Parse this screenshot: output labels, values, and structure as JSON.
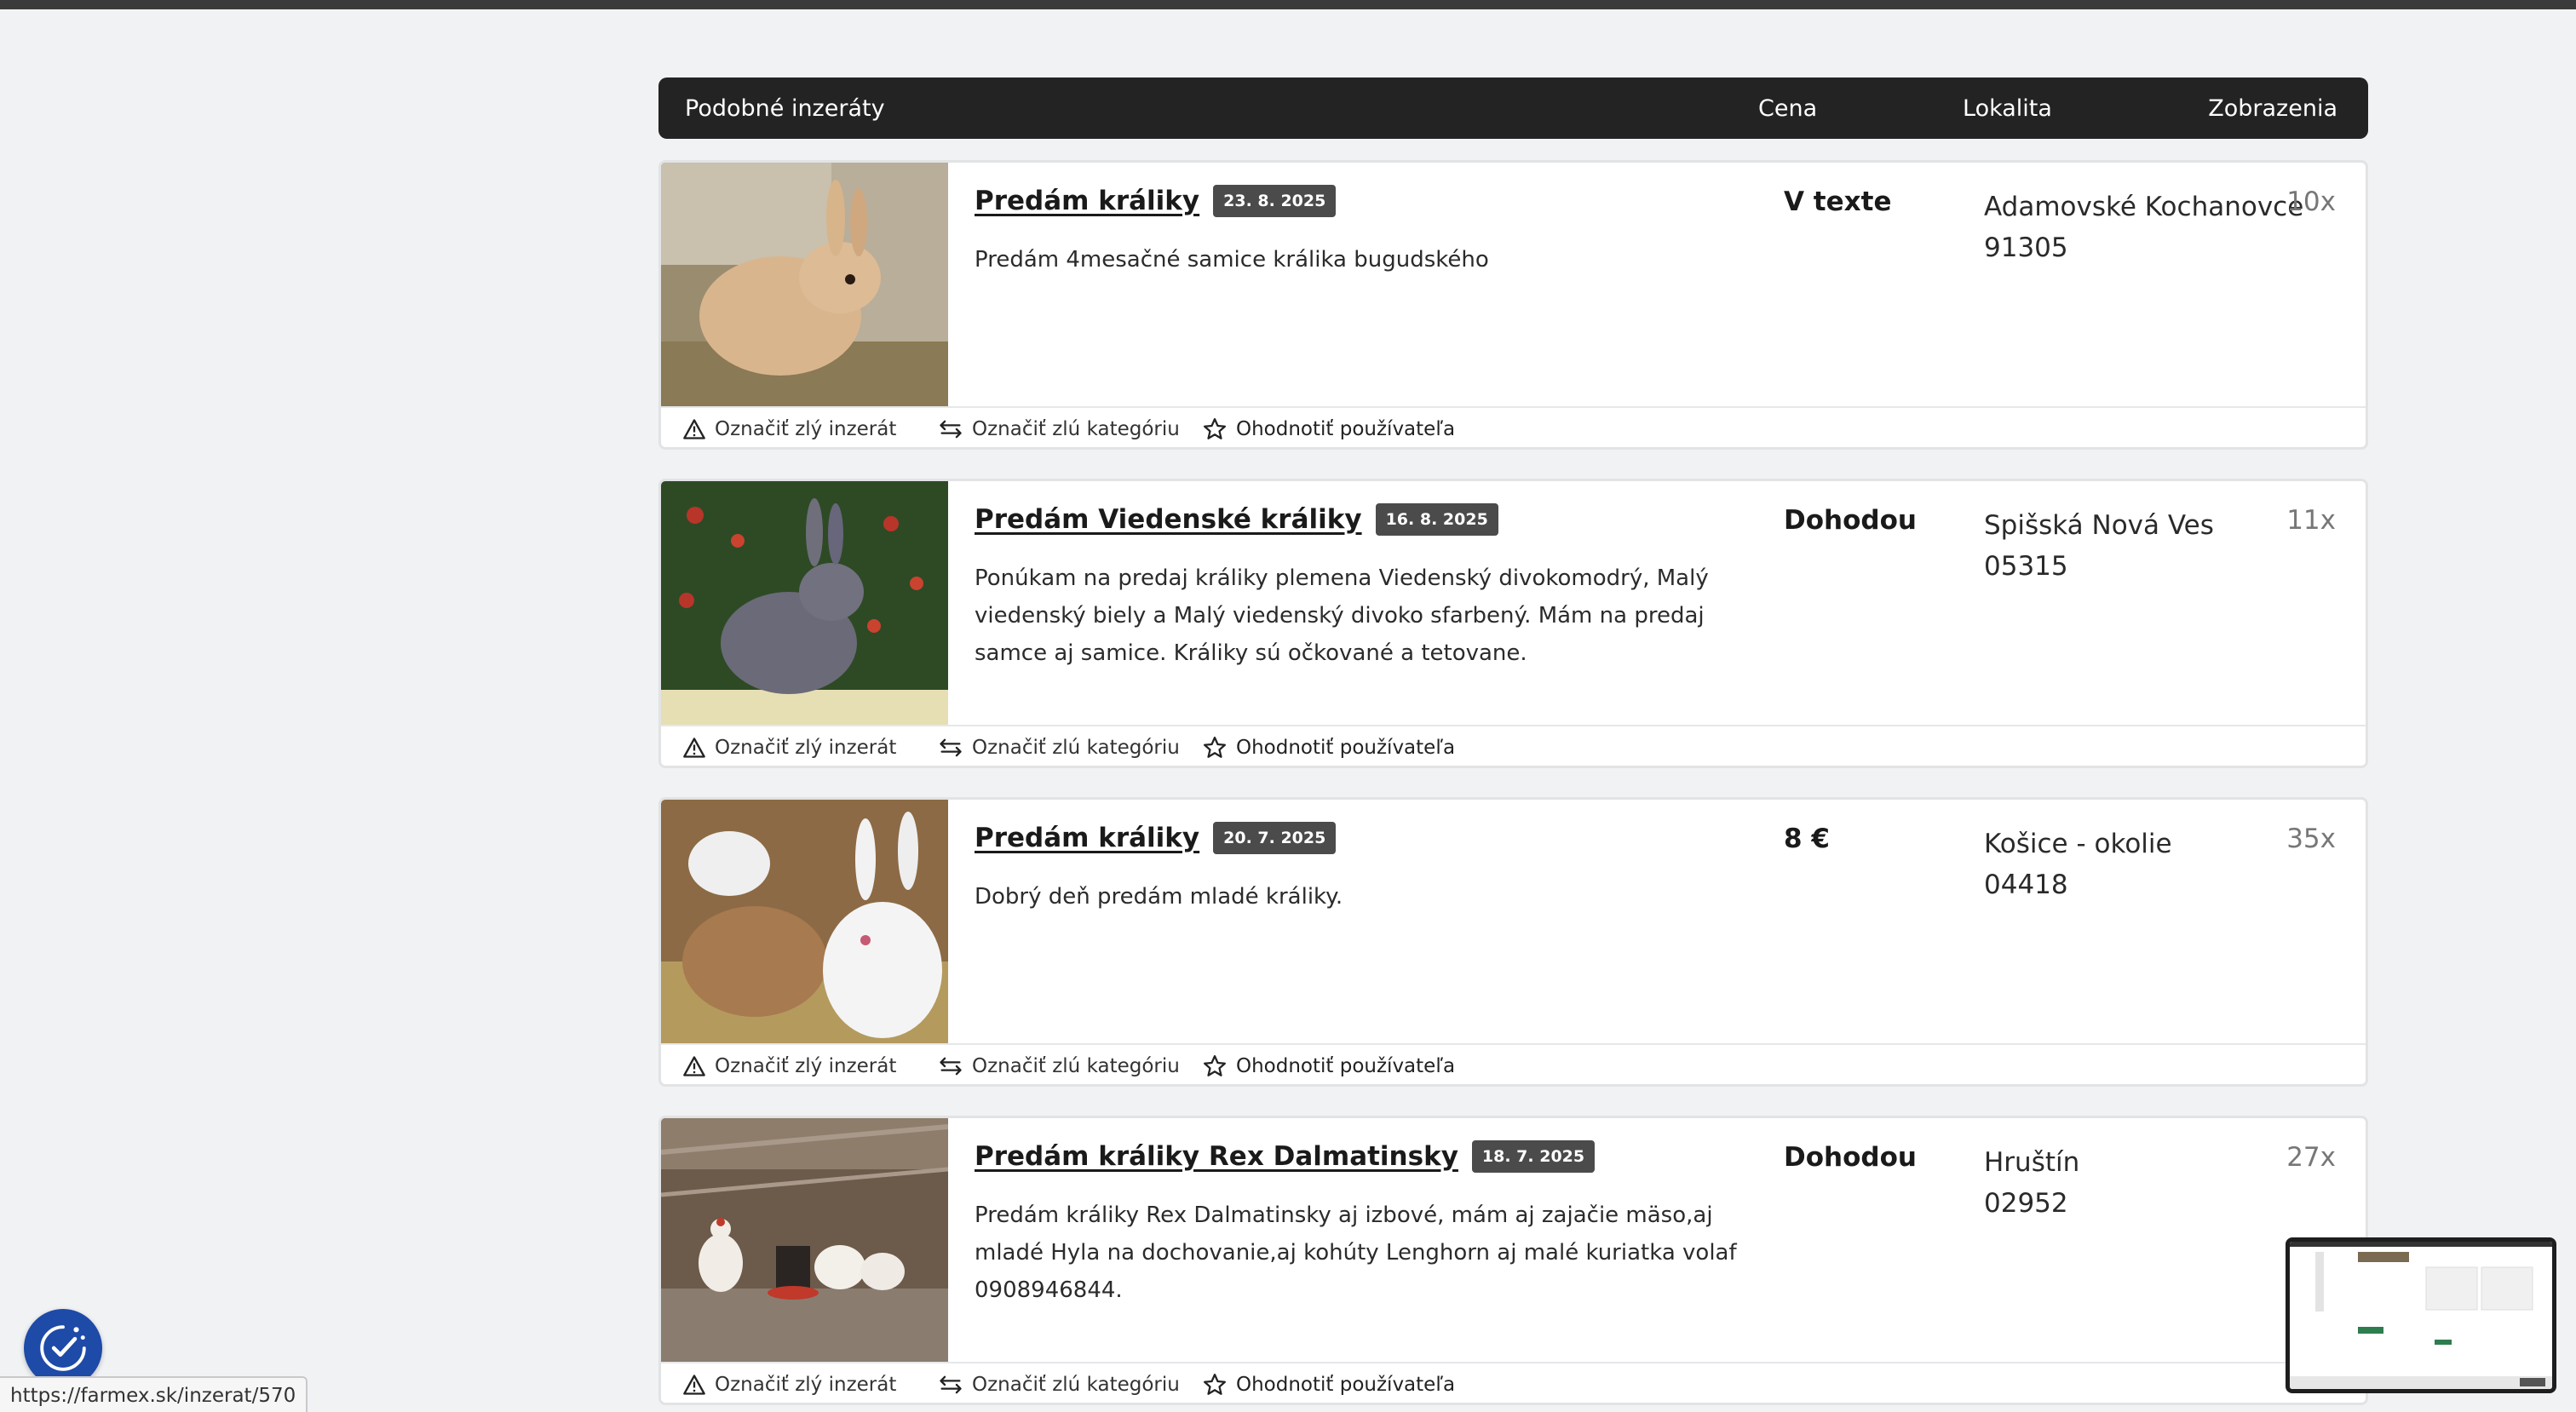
{
  "header": {
    "title": "Podobné inzeráty",
    "price": "Cena",
    "location": "Lokalita",
    "views": "Zobrazenia"
  },
  "actions": {
    "flag_ad": "Označiť zlý inzerát",
    "flag_category": "Označiť zlú kategóriu",
    "rate_user": "Ohodnotiť používateľa"
  },
  "listings": [
    {
      "title": "Predám králiky",
      "date": "23. 8. 2025",
      "description": "Predám 4mesačné samice králika bugudského",
      "price": "V texte",
      "location": "Adamovské Kochanovce",
      "postal_code": "91305",
      "views": "10x"
    },
    {
      "title": "Predám Viedenské králiky",
      "date": "16. 8. 2025",
      "description": "Ponúkam na predaj králiky plemena Viedenský divokomodrý, Malý viedenský biely a Malý viedenský divoko sfarbený. Mám na predaj samce aj samice. Králiky sú očkované a tetovane.",
      "price": "Dohodou",
      "location": "Spišská Nová Ves",
      "postal_code": "05315",
      "views": "11x"
    },
    {
      "title": "Predám králiky",
      "date": "20. 7. 2025",
      "description": "Dobrý deň predám mladé králiky.",
      "price": "8 €",
      "location": "Košice - okolie",
      "postal_code": "04418",
      "views": "35x"
    },
    {
      "title": "Predám králiky Rex Dalmatinsky",
      "date": "18. 7. 2025",
      "description": "Predám králiky Rex Dalmatinsky aj izbové, mám aj zajačie mäso,aj mladé Hyla na dochovanie,aj kohúty Lenghorn aj malé kuriatka volaf 0908946844.",
      "price": "Dohodou",
      "location": "Hruštín",
      "postal_code": "02952",
      "views": "27x"
    }
  ],
  "status_url": "https://farmex.sk/inzerat/570",
  "icons": {
    "flag_ad": "warning-triangle-icon",
    "flag_category": "swap-arrows-icon",
    "rate_user": "star-icon",
    "fab": "cookie-consent-icon"
  }
}
